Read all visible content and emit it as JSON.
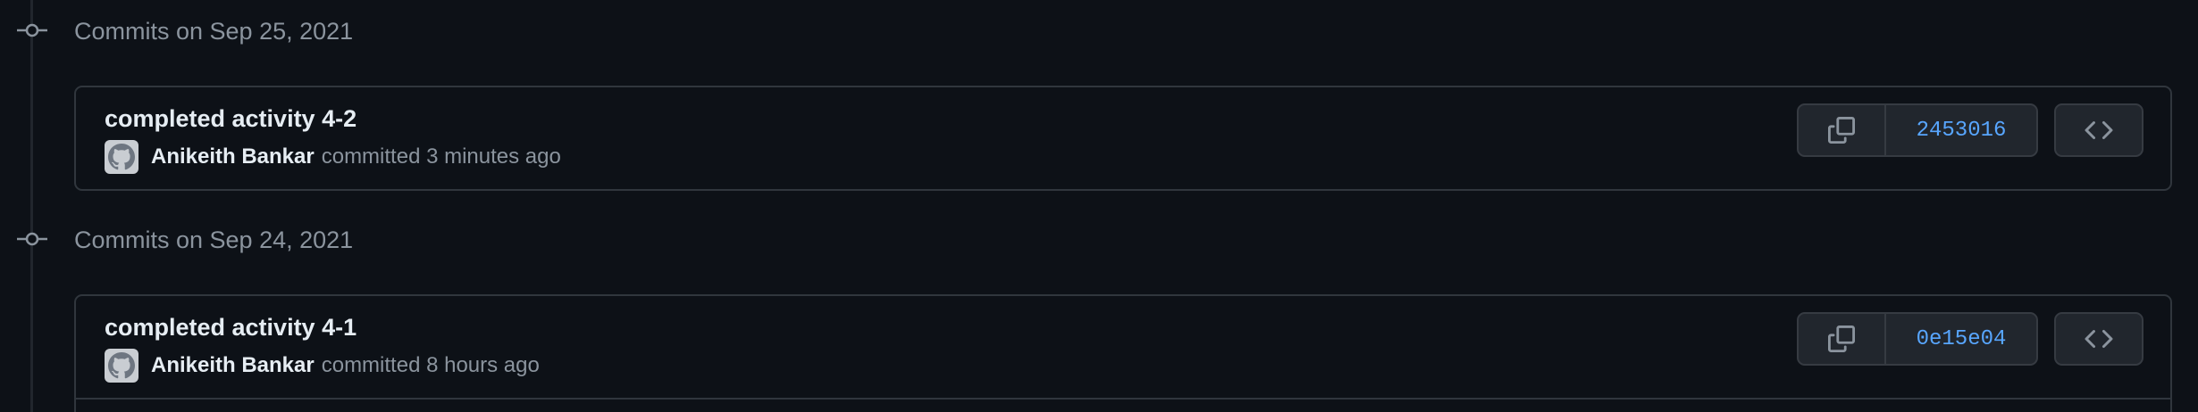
{
  "groups": [
    {
      "title": "Commits on Sep 25, 2021",
      "commits": [
        {
          "title": "completed activity 4-2",
          "author": "Anikeith Bankar",
          "meta": "committed 3 minutes ago",
          "sha": "2453016"
        }
      ]
    },
    {
      "title": "Commits on Sep 24, 2021",
      "commits": [
        {
          "title": "completed activity 4-1",
          "author": "Anikeith Bankar",
          "meta": "committed 8 hours ago",
          "sha": "0e15e04"
        }
      ]
    }
  ],
  "icons": {
    "commit_node": "git-commit-icon",
    "avatar": "github-octocat-icon",
    "copy": "copy-icon",
    "browse": "code-icon"
  },
  "colors": {
    "background": "#0d1117",
    "border": "#30363d",
    "button_bg": "#21262d",
    "text_primary": "#e6edf3",
    "text_muted": "#8b949e",
    "link": "#58a6ff"
  }
}
